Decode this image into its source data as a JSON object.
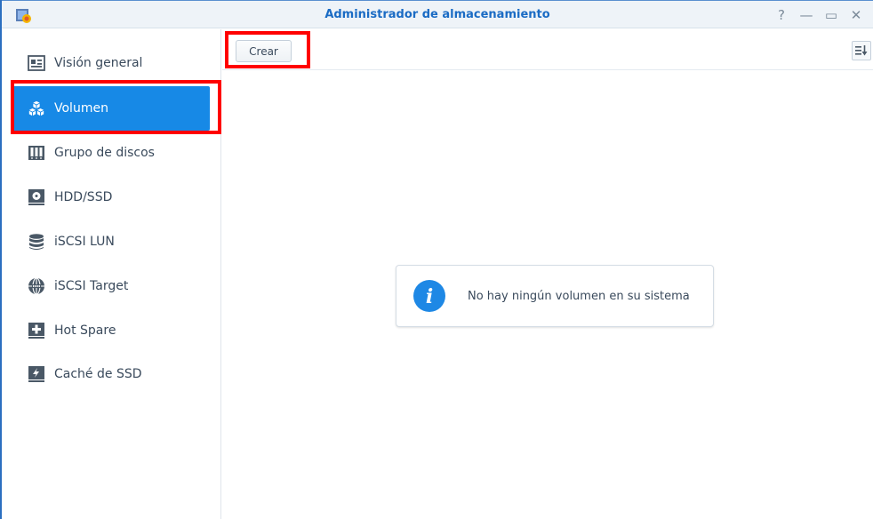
{
  "window": {
    "title": "Administrador de almacenamiento",
    "controls": [
      "?",
      "—",
      "▭",
      "✕"
    ]
  },
  "sidebar": {
    "items": [
      {
        "label": "Visión general",
        "icon": "overview-icon",
        "active": false
      },
      {
        "label": "Volumen",
        "icon": "volume-cubes-icon",
        "active": true
      },
      {
        "label": "Grupo de discos",
        "icon": "disk-group-icon",
        "active": false
      },
      {
        "label": "HDD/SSD",
        "icon": "hdd-icon",
        "active": false
      },
      {
        "label": "iSCSI LUN",
        "icon": "database-icon",
        "active": false
      },
      {
        "label": "iSCSI Target",
        "icon": "globe-icon",
        "active": false
      },
      {
        "label": "Hot Spare",
        "icon": "hot-spare-icon",
        "active": false
      },
      {
        "label": "Caché de SSD",
        "icon": "ssd-cache-icon",
        "active": false
      }
    ]
  },
  "toolbar": {
    "create_label": "Crear"
  },
  "main": {
    "empty_message": "No hay ningún volumen en su sistema"
  },
  "colors": {
    "accent": "#1789e6",
    "highlight": "#ff0000",
    "title": "#1a6bc4"
  }
}
